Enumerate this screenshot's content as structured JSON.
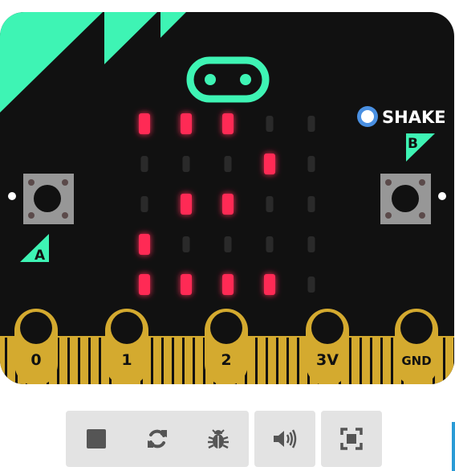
{
  "board": {
    "body_color": "#111111",
    "accent_color": "#3ef4b4",
    "gold_color": "#d4aa2f",
    "led_on_color": "#ff2a55",
    "led_off_color": "#2a2a2a"
  },
  "shake": {
    "label": "SHAKE"
  },
  "buttons": {
    "a_label": "A",
    "b_label": "B"
  },
  "pins": [
    "0",
    "1",
    "2",
    "3V",
    "GND"
  ],
  "led_matrix": [
    [
      1,
      1,
      1,
      0,
      0
    ],
    [
      0,
      0,
      0,
      1,
      0
    ],
    [
      0,
      1,
      1,
      0,
      0
    ],
    [
      1,
      0,
      0,
      0,
      0
    ],
    [
      1,
      1,
      1,
      1,
      0
    ]
  ],
  "toolbar": {
    "stop": {
      "icon": "stop-icon"
    },
    "restart": {
      "icon": "restart-icon"
    },
    "debug": {
      "icon": "bug-icon"
    },
    "sound": {
      "icon": "speaker-icon"
    },
    "fullscreen": {
      "icon": "fullscreen-icon"
    }
  }
}
